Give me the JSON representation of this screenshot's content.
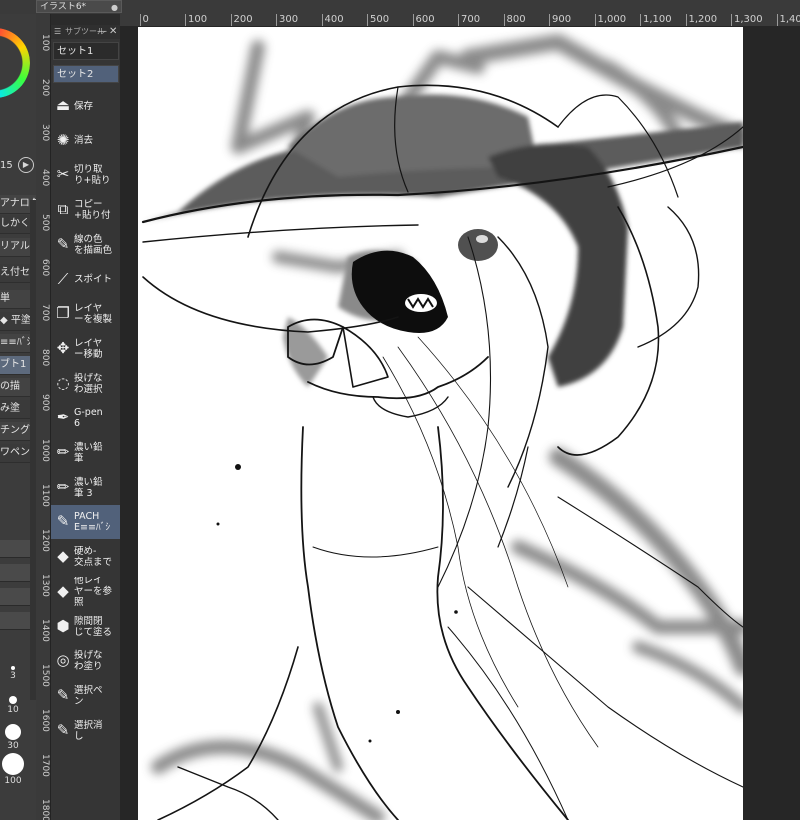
{
  "document_tab": {
    "title": "イラスト6*",
    "pin": "●"
  },
  "h_ruler": {
    "ticks": [
      "100",
      "0",
      "100",
      "200",
      "300",
      "400",
      "500",
      "600",
      "700",
      "800",
      "900",
      "1,000",
      "1,100",
      "1,200",
      "1,300",
      "1,400"
    ]
  },
  "v_ruler": {
    "ticks": [
      "100",
      "200",
      "300",
      "400",
      "500",
      "600",
      "700",
      "800",
      "900",
      "1000",
      "1100",
      "1200",
      "1300",
      "1400",
      "1500",
      "1600",
      "1700",
      "1800"
    ]
  },
  "subtool_panel": {
    "title": "サブツール",
    "menu_icon": "☰",
    "min_label": "—",
    "close_label": "✕",
    "sets": [
      "セット1",
      "セット2"
    ],
    "tools": [
      {
        "label": "保存",
        "icon": "save-icon",
        "glyph": "⏏",
        "active": false
      },
      {
        "label": "消去",
        "icon": "clear-icon",
        "glyph": "✺",
        "active": false
      },
      {
        "label": "切り取\nり+貼り",
        "icon": "cut-icon",
        "glyph": "✂",
        "active": false
      },
      {
        "label": "コピー\n+貼り付",
        "icon": "copy-icon",
        "glyph": "⧉",
        "active": false
      },
      {
        "label": "線の色\nを描画色",
        "icon": "line-color-icon",
        "glyph": "✎",
        "active": false
      },
      {
        "label": "スポイト",
        "icon": "eyedropper-icon",
        "glyph": "⟋",
        "active": false
      },
      {
        "label": "レイヤ\nーを複製",
        "icon": "layer-duplicate-icon",
        "glyph": "❐",
        "active": false
      },
      {
        "label": "レイヤ\nー移動",
        "icon": "layer-move-icon",
        "glyph": "✥",
        "active": false
      },
      {
        "label": "投げな\nわ選択",
        "icon": "lasso-icon",
        "glyph": "◌",
        "active": false
      },
      {
        "label": "G-pen\n6",
        "icon": "pen-icon",
        "glyph": "✒",
        "active": false
      },
      {
        "label": "濃い鉛\n筆",
        "icon": "pencil-icon",
        "glyph": "✏",
        "active": false
      },
      {
        "label": "濃い鉛\n筆 3",
        "icon": "pencil-icon",
        "glyph": "✏",
        "active": false
      },
      {
        "label": "PACH\nE≡≡ﾊﾞｼ",
        "icon": "brush-icon",
        "glyph": "✎",
        "active": true
      },
      {
        "label": "硬め-\n交点まで",
        "icon": "eraser-icon",
        "glyph": "◆",
        "active": false
      },
      {
        "label": "他レイ\nヤーを参照",
        "icon": "fill-icon",
        "glyph": "◆",
        "active": false
      },
      {
        "label": "隙間閉\nじて塗る",
        "icon": "fill-gap-icon",
        "glyph": "⬢",
        "active": false
      },
      {
        "label": "投げな\nわ塗り",
        "icon": "lasso-fill-icon",
        "glyph": "◎",
        "active": false
      },
      {
        "label": "選択ペ\nン",
        "icon": "selection-pen-icon",
        "glyph": "✎",
        "active": false
      },
      {
        "label": "選択消\nし",
        "icon": "selection-erase-icon",
        "glyph": "✎",
        "active": false
      }
    ]
  },
  "left_panel": {
    "brush_size": "15",
    "play_glyph": "▶",
    "sub_items": [
      "アナログ",
      "しかくい",
      "リアルホ",
      "え付セ",
      "単",
      "◆ 平塗",
      "≡≡ﾊﾞｼ",
      "ブト1",
      "の描",
      "み塗",
      "チング",
      "ワペン"
    ],
    "size_labels": [
      "3",
      "10",
      "30",
      "100"
    ]
  }
}
